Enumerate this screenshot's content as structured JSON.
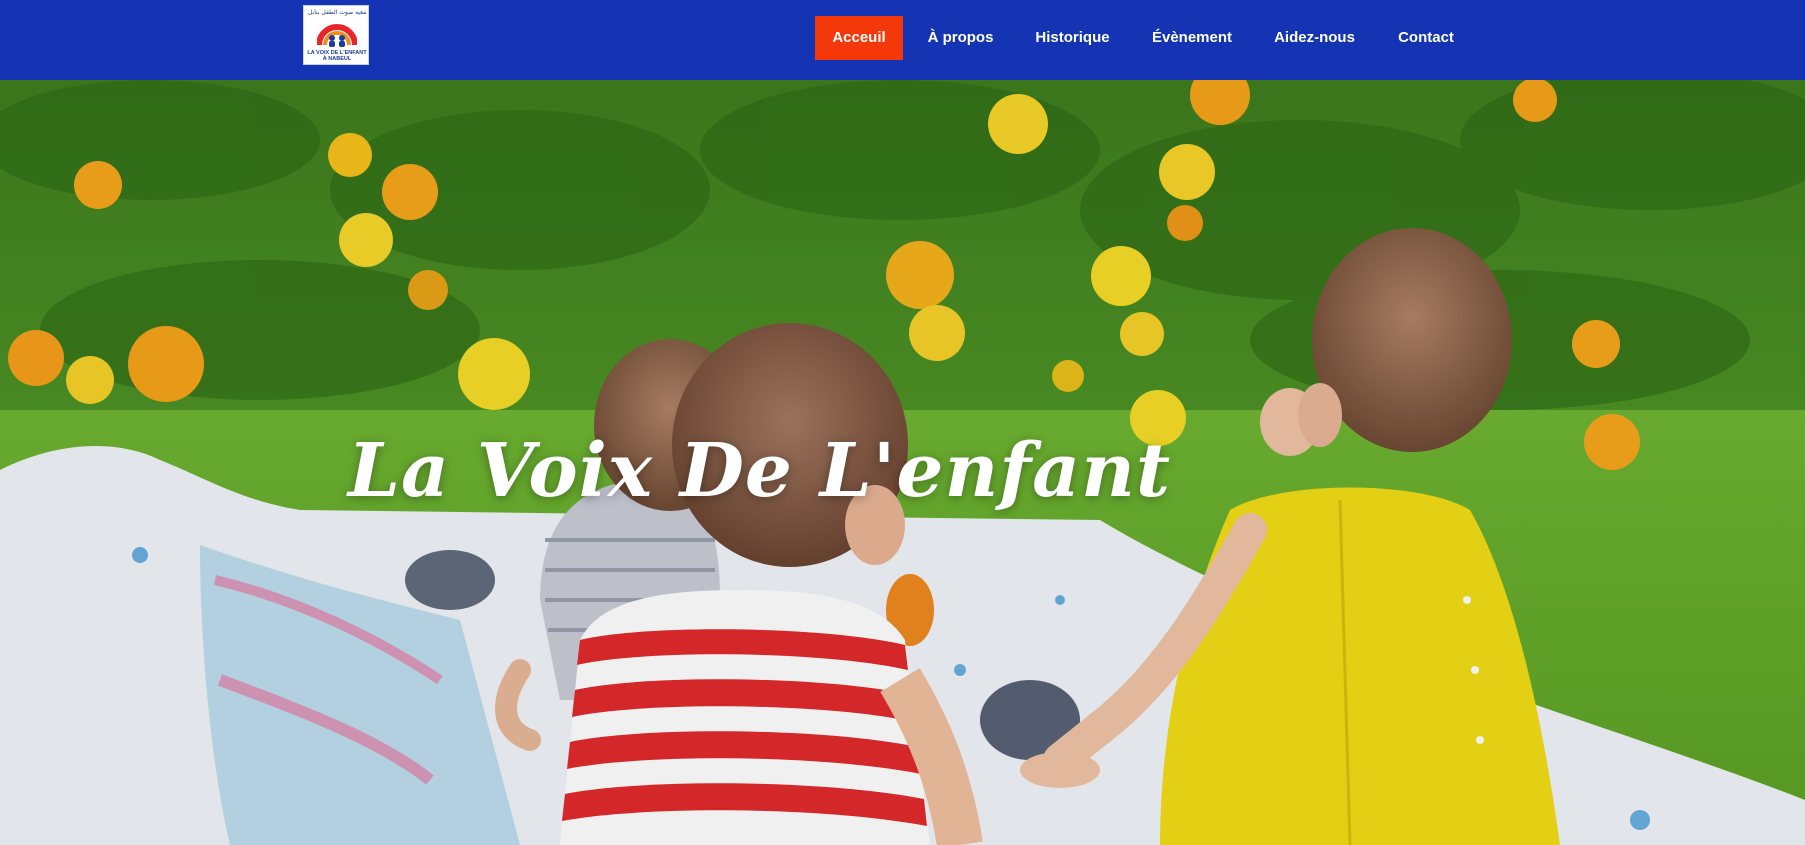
{
  "brand": {
    "logo_arabic": "جمعية صوت الطفل بنابل",
    "logo_caption": "LA VOIX DE L'ENFANT À NABEUL"
  },
  "nav": {
    "items": [
      {
        "label": "Acceuil",
        "active": true
      },
      {
        "label": "À propos",
        "active": false
      },
      {
        "label": "Historique",
        "active": false
      },
      {
        "label": "Évènement",
        "active": false
      },
      {
        "label": "Aidez-nous",
        "active": false
      },
      {
        "label": "Contact",
        "active": false
      }
    ]
  },
  "hero": {
    "title": "La Voix De L'enfant",
    "image": "children-on-picnic-blanket-photo"
  },
  "colors": {
    "header_bg": "#1434b4",
    "active_nav_bg": "#f4380a",
    "nav_text": "#ffffff"
  }
}
